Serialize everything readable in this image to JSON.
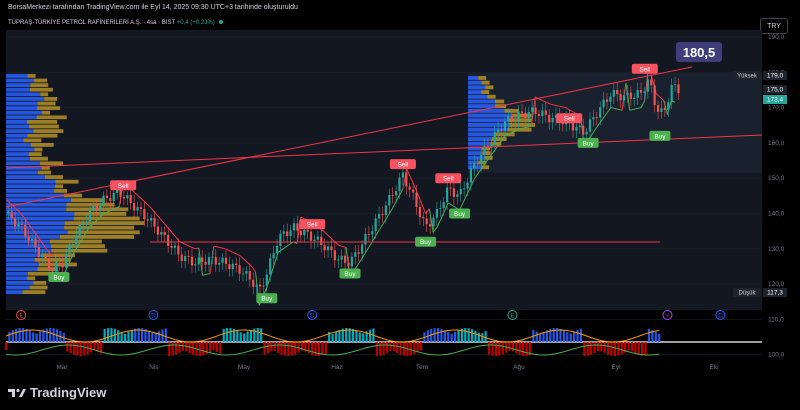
{
  "header": {
    "attribution": "BorsaMerkezi tarafından TradingView.com ile Eyl 14, 2025 09:30 UTC+3 tarihinde oluşturuldu",
    "currency": "TRY",
    "symbol": "TÜPRAŞ-TÜRKİYE PETROL RAFİNERİLERİ A.Ş. · 4sa · BIST",
    "change": "+0,4 (+0,23%)"
  },
  "brand": {
    "name": "TradingView",
    "icon": "tradingview-logo-icon"
  },
  "colors": {
    "bg": "#000000",
    "panel": "#131722",
    "up": "#26a69a",
    "down": "#ef5350",
    "trendline": "#f23645",
    "vp_blue": "#2962ff",
    "vp_gold": "#c9a227",
    "stop_green": "#4caf50",
    "stop_red": "#f23645",
    "target_box": "#3f3d7a"
  },
  "chart_data": {
    "type": "candlestick",
    "y_axis": {
      "min": 110,
      "max": 190,
      "ticks": [
        "190,0",
        "180,0",
        "170,0",
        "160,0",
        "150,0",
        "140,0",
        "130,0",
        "120,0",
        "110,0",
        "100,0"
      ]
    },
    "x_axis": {
      "ticks": [
        "Mar",
        "Nis",
        "May",
        "Haz",
        "Tem",
        "Ağu",
        "Eyl",
        "Eki"
      ]
    },
    "price_labels": [
      {
        "label": "Yüksek",
        "value": "179,0"
      },
      {
        "value": "175,0"
      },
      {
        "value": "173,4"
      },
      {
        "label": "Düşük",
        "value": "117,3"
      }
    ],
    "target": {
      "value": "180,5"
    },
    "signals": [
      {
        "text": "Buy",
        "type": "buy",
        "t": 0.07,
        "price": 122
      },
      {
        "text": "Sell",
        "type": "sell",
        "t": 0.155,
        "price": 148
      },
      {
        "text": "Sell",
        "type": "sell",
        "t": 0.405,
        "price": 137
      },
      {
        "text": "Buy",
        "type": "buy",
        "t": 0.345,
        "price": 116
      },
      {
        "text": "Buy",
        "type": "buy",
        "t": 0.455,
        "price": 123
      },
      {
        "text": "Sell",
        "type": "sell",
        "t": 0.525,
        "price": 154
      },
      {
        "text": "Buy",
        "type": "buy",
        "t": 0.555,
        "price": 132
      },
      {
        "text": "Sell",
        "type": "sell",
        "t": 0.585,
        "price": 150
      },
      {
        "text": "Buy",
        "type": "buy",
        "t": 0.6,
        "price": 140
      },
      {
        "text": "Sell",
        "type": "sell",
        "t": 0.745,
        "price": 167
      },
      {
        "text": "Buy",
        "type": "buy",
        "t": 0.77,
        "price": 160
      },
      {
        "text": "Sell",
        "type": "sell",
        "t": 0.845,
        "price": 181
      },
      {
        "text": "Buy",
        "type": "buy",
        "t": 0.865,
        "price": 162
      }
    ],
    "indicator_markers": [
      {
        "text": "E",
        "t": 0.02
      },
      {
        "text": "D",
        "t": 0.195
      },
      {
        "text": "D",
        "t": 0.405
      },
      {
        "text": "E",
        "t": 0.67
      },
      {
        "text": "⚡",
        "t": 0.875
      },
      {
        "text": "D",
        "t": 0.945
      }
    ]
  }
}
